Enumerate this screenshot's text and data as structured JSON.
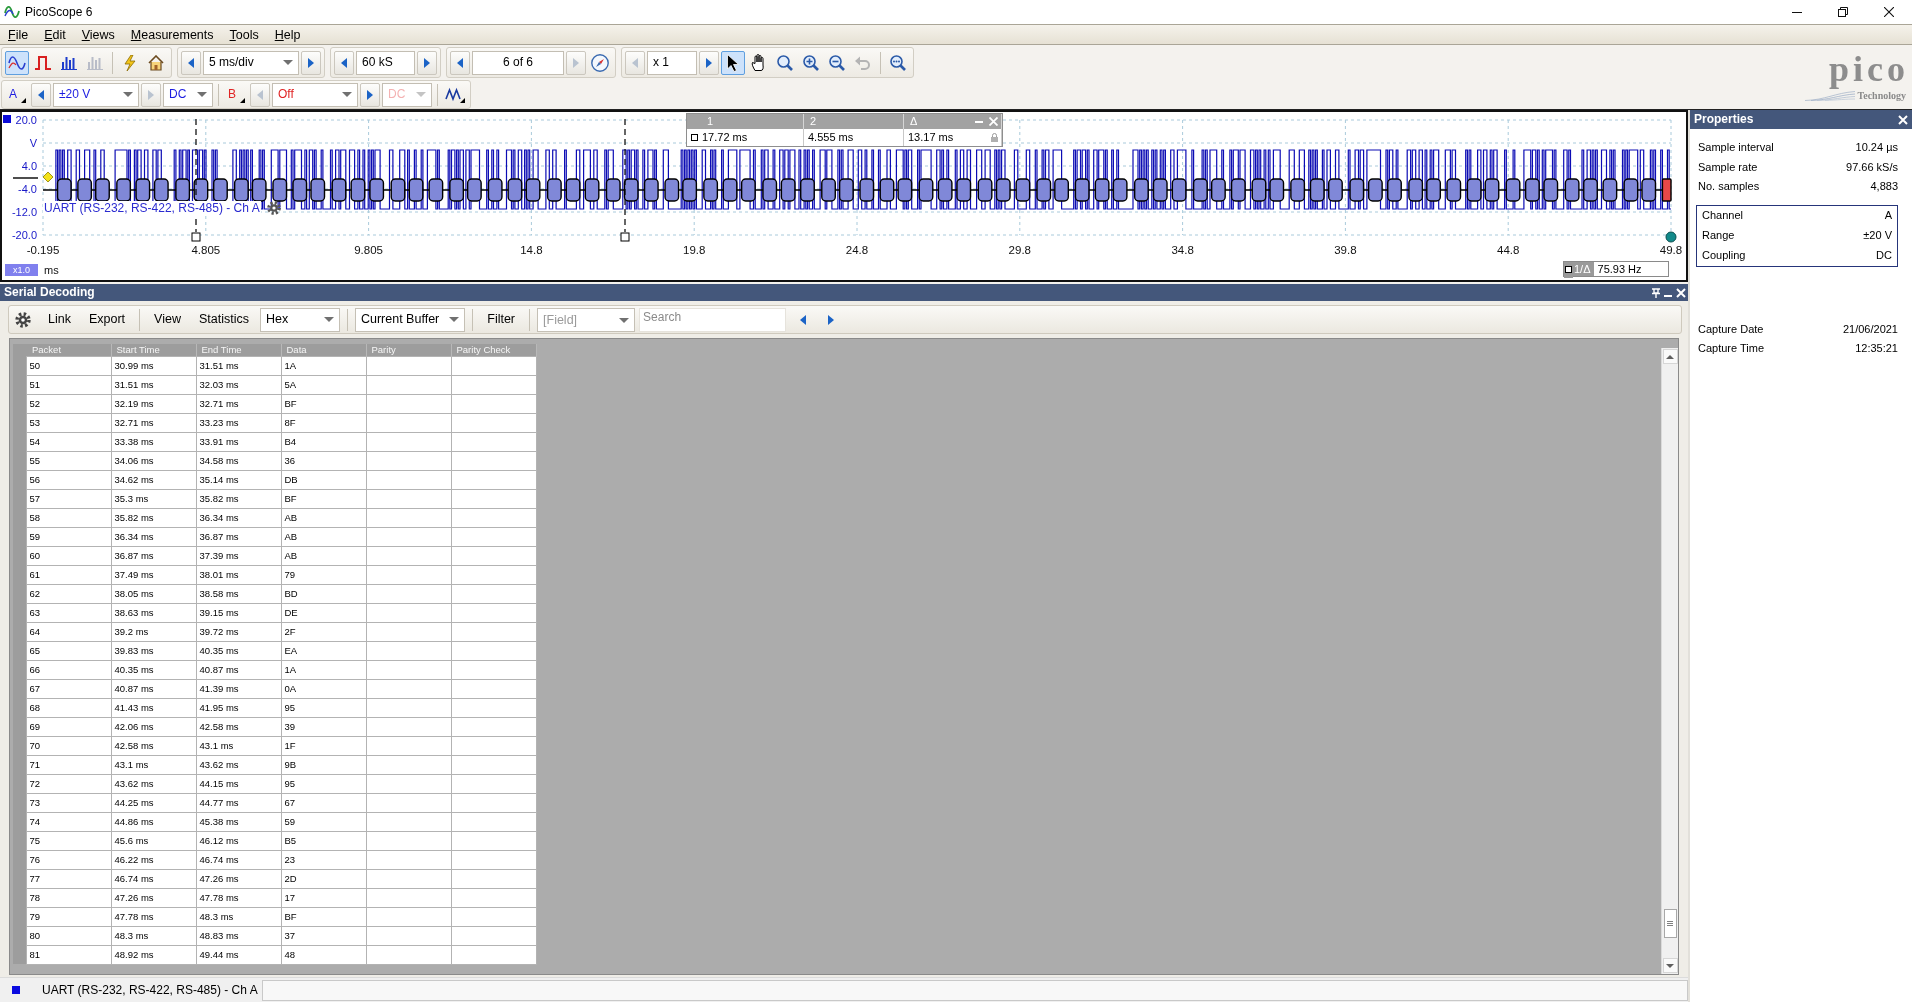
{
  "window": {
    "title": "PicoScope 6"
  },
  "menu": [
    "File",
    "Edit",
    "Views",
    "Measurements",
    "Tools",
    "Help"
  ],
  "toolbar": {
    "modes": [
      {
        "kind": "scope",
        "selected": true,
        "disabled": false
      },
      {
        "kind": "persistence",
        "selected": false,
        "disabled": false
      },
      {
        "kind": "spectrum",
        "selected": false,
        "disabled": false
      },
      {
        "kind": "xy",
        "selected": false,
        "disabled": true
      }
    ],
    "actions": [
      {
        "kind": "probe"
      },
      {
        "kind": "home"
      }
    ],
    "timebase": {
      "value": "5 ms/div",
      "prev_disabled": false,
      "next_disabled": false
    },
    "samples": {
      "value": "60 kS",
      "prev_disabled": false,
      "next_disabled": false
    },
    "buffer": {
      "value": "6 of 6",
      "prev_disabled": false,
      "next_disabled": true
    },
    "zoom": {
      "value": "x 1",
      "prev_disabled": true,
      "next_disabled": false
    },
    "tools": [
      {
        "kind": "pointer",
        "selected": true,
        "disabled": false
      },
      {
        "kind": "hand",
        "selected": false,
        "disabled": false
      },
      {
        "kind": "zoom",
        "selected": false,
        "disabled": false
      },
      {
        "kind": "zoom-in",
        "selected": false,
        "disabled": false
      },
      {
        "kind": "zoom-out",
        "selected": false,
        "disabled": false
      },
      {
        "kind": "undo-zoom",
        "selected": false,
        "disabled": true
      },
      {
        "kind": "zoom-fit",
        "selected": false,
        "disabled": false
      }
    ]
  },
  "channels": [
    {
      "label": "A",
      "color": "#1c1ce0",
      "range": "±20 V",
      "coupling": "DC",
      "enabled": true,
      "range_prev_disabled": false,
      "range_next_disabled": true
    },
    {
      "label": "B",
      "color": "#e02424",
      "range": "Off",
      "coupling": "DC",
      "enabled": false,
      "range_prev_disabled": true,
      "range_next_disabled": false
    }
  ],
  "logo": {
    "name": "pico",
    "tagline": "Technology"
  },
  "scope": {
    "y_labels": [
      "20.0",
      "V",
      "4.0",
      "-4.0",
      "-12.0",
      "-20.0"
    ],
    "x_labels": [
      "-0.195",
      "4.805",
      "9.805",
      "14.8",
      "19.8",
      "24.8",
      "29.8",
      "34.8",
      "39.8",
      "44.8",
      "49.8"
    ],
    "x_unit": "ms",
    "zoom_factor": "x1.0",
    "decoder_label": "UART (RS-232, RS-422, RS-485) - Ch A",
    "cursor_table": {
      "headers": [
        "1",
        "2",
        "Δ"
      ],
      "values": [
        "17.72 ms",
        "4.555 ms",
        "13.17 ms"
      ]
    },
    "frequency": {
      "label": "1/Δ",
      "value": "75.93 Hz"
    }
  },
  "properties": {
    "title": "Properties",
    "timing": [
      {
        "label": "Sample interval",
        "value": "10.24 µs"
      },
      {
        "label": "Sample rate",
        "value": "97.66 kS/s"
      },
      {
        "label": "No. samples",
        "value": "4,883"
      }
    ],
    "channel": [
      {
        "label": "Channel",
        "value": "A"
      },
      {
        "label": "Range",
        "value": "±20 V"
      },
      {
        "label": "Coupling",
        "value": "DC"
      }
    ],
    "capture": [
      {
        "label": "Capture Date",
        "value": "21/06/2021"
      },
      {
        "label": "Capture Time",
        "value": "12:35:21"
      }
    ]
  },
  "serial_decoding": {
    "title": "Serial Decoding",
    "toolbar": [
      {
        "kind": "settings"
      },
      {
        "kind": "button",
        "label": "Link"
      },
      {
        "kind": "button",
        "label": "Export"
      },
      {
        "kind": "separator"
      },
      {
        "kind": "button",
        "label": "View"
      },
      {
        "kind": "button",
        "label": "Statistics"
      },
      {
        "kind": "dropdown",
        "value": "Hex"
      },
      {
        "kind": "separator"
      },
      {
        "kind": "dropdown",
        "value": "Current Buffer"
      },
      {
        "kind": "separator"
      },
      {
        "kind": "button",
        "label": "Filter"
      },
      {
        "kind": "separator"
      },
      {
        "kind": "field_dropdown",
        "placeholder": "[Field]"
      },
      {
        "kind": "search",
        "placeholder": "Search"
      },
      {
        "kind": "navigation"
      }
    ],
    "table": {
      "columns": [
        "Packet",
        "Start Time",
        "End Time",
        "Data",
        "Parity",
        "Parity Check"
      ],
      "rows": [
        [
          "50",
          "30.99 ms",
          "31.51 ms",
          "1A"
        ],
        [
          "51",
          "31.51 ms",
          "32.03 ms",
          "5A"
        ],
        [
          "52",
          "32.19 ms",
          "32.71 ms",
          "BF"
        ],
        [
          "53",
          "32.71 ms",
          "33.23 ms",
          "8F"
        ],
        [
          "54",
          "33.38 ms",
          "33.91 ms",
          "B4"
        ],
        [
          "55",
          "34.06 ms",
          "34.58 ms",
          "36"
        ],
        [
          "56",
          "34.62 ms",
          "35.14 ms",
          "DB"
        ],
        [
          "57",
          "35.3 ms",
          "35.82 ms",
          "BF"
        ],
        [
          "58",
          "35.82 ms",
          "36.34 ms",
          "AB"
        ],
        [
          "59",
          "36.34 ms",
          "36.87 ms",
          "AB"
        ],
        [
          "60",
          "36.87 ms",
          "37.39 ms",
          "AB"
        ],
        [
          "61",
          "37.49 ms",
          "38.01 ms",
          "79"
        ],
        [
          "62",
          "38.05 ms",
          "38.58 ms",
          "BD"
        ],
        [
          "63",
          "38.63 ms",
          "39.15 ms",
          "DE"
        ],
        [
          "64",
          "39.2 ms",
          "39.72 ms",
          "2F"
        ],
        [
          "65",
          "39.83 ms",
          "40.35 ms",
          "EA"
        ],
        [
          "66",
          "40.35 ms",
          "40.87 ms",
          "1A"
        ],
        [
          "67",
          "40.87 ms",
          "41.39 ms",
          "0A"
        ],
        [
          "68",
          "41.43 ms",
          "41.95 ms",
          "95"
        ],
        [
          "69",
          "42.06 ms",
          "42.58 ms",
          "39"
        ],
        [
          "70",
          "42.58 ms",
          "43.1 ms",
          "1F"
        ],
        [
          "71",
          "43.1 ms",
          "43.62 ms",
          "9B"
        ],
        [
          "72",
          "43.62 ms",
          "44.15 ms",
          "95"
        ],
        [
          "73",
          "44.25 ms",
          "44.77 ms",
          "67"
        ],
        [
          "74",
          "44.86 ms",
          "45.38 ms",
          "59"
        ],
        [
          "75",
          "45.6 ms",
          "46.12 ms",
          "B5"
        ],
        [
          "76",
          "46.22 ms",
          "46.74 ms",
          "23"
        ],
        [
          "77",
          "46.74 ms",
          "47.26 ms",
          "2D"
        ],
        [
          "78",
          "47.26 ms",
          "47.78 ms",
          "17"
        ],
        [
          "79",
          "47.78 ms",
          "48.3 ms",
          "BF"
        ],
        [
          "80",
          "48.3 ms",
          "48.83 ms",
          "37"
        ],
        [
          "81",
          "48.92 ms",
          "49.44 ms",
          "48"
        ]
      ]
    }
  },
  "status_bar": {
    "label": "UART (RS-232, RS-422, RS-485) - Ch A"
  }
}
